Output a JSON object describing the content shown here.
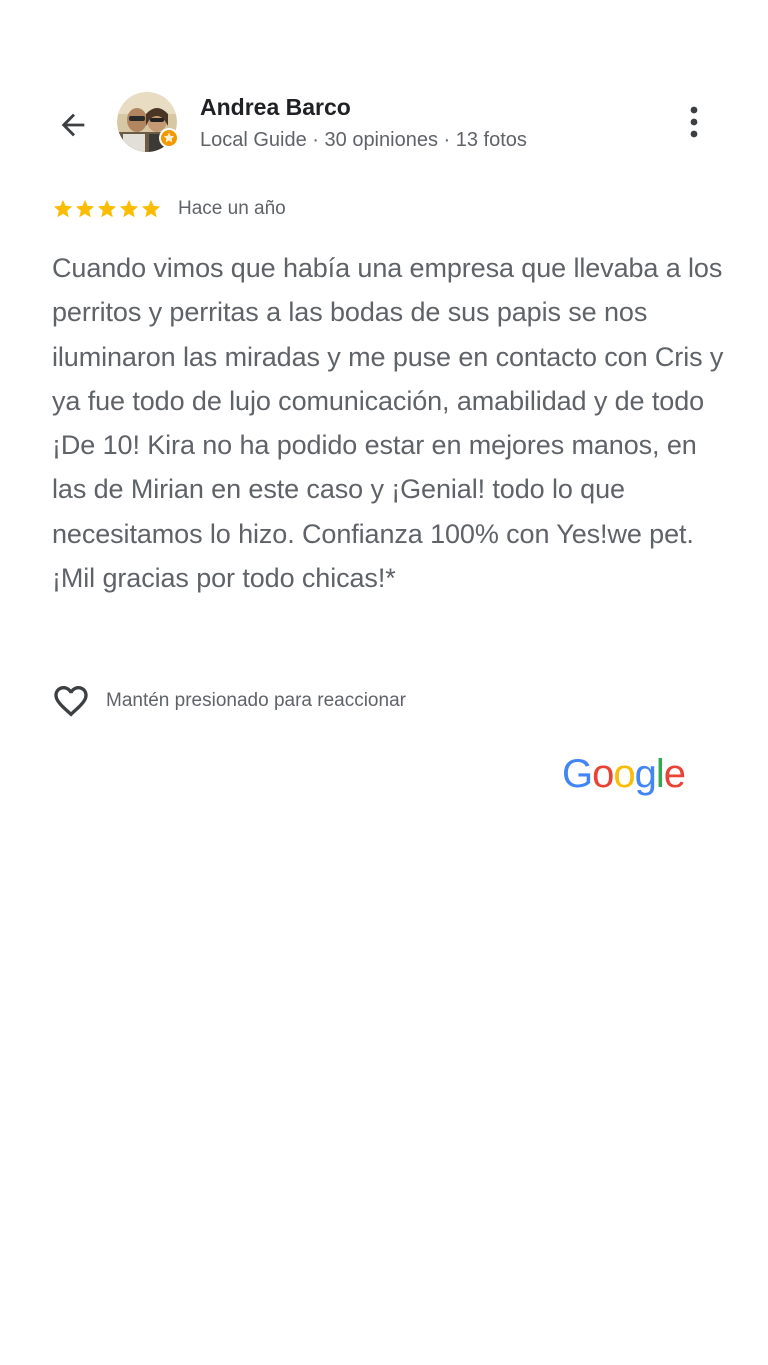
{
  "header": {
    "back_icon": "arrow-back-icon",
    "user_name": "Andrea Barco",
    "user_meta": "Local Guide · 30 opiniones · 13 fotos",
    "avatar_icon": "avatar",
    "badge_icon": "local-guide-badge-icon",
    "more_icon": "more-vertical-icon"
  },
  "review": {
    "rating": 5,
    "rating_max": 5,
    "star_color": "#fbbc04",
    "time_ago": "Hace un año",
    "text": "Cuando vimos que había una empresa que llevaba a los perritos y perritas a las bodas de sus papis se nos iluminaron las miradas y me puse en contacto con Cris y ya fue todo de lujo comunicación, amabilidad y de todo ¡De 10! Kira no ha podido estar en mejores manos, en las de Mirian en este caso y ¡Genial! todo lo que necesitamos lo hizo. Confianza 100% con Yes!we pet. ¡Mil gracias por todo chicas!*"
  },
  "reaction": {
    "heart_icon": "heart-outline-icon",
    "hint": "Mantén presionado para reaccionar"
  },
  "branding": {
    "logo_letters": [
      "G",
      "o",
      "o",
      "g",
      "l",
      "e"
    ],
    "logo_colors": [
      "#4285f4",
      "#ea4335",
      "#fbbc05",
      "#4285f4",
      "#34a853",
      "#ea4335"
    ]
  },
  "colors": {
    "text_primary": "#202124",
    "text_secondary": "#5f6368",
    "icon": "#3c4043"
  }
}
